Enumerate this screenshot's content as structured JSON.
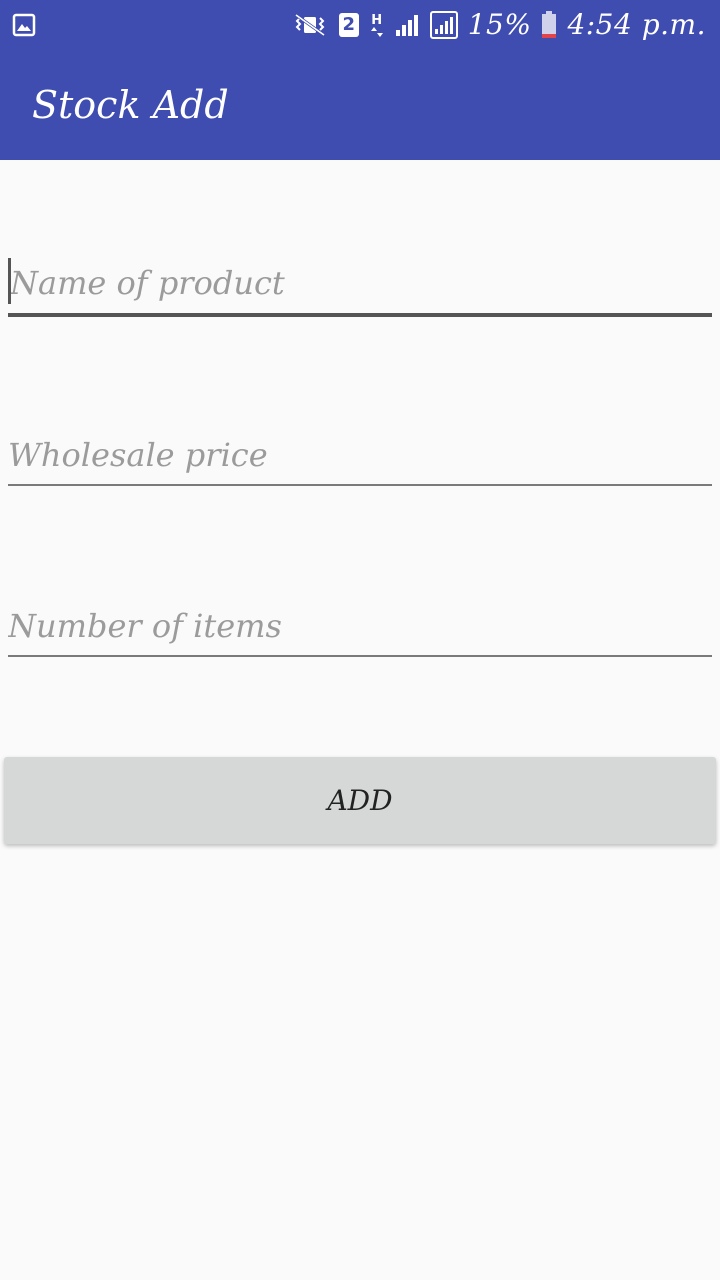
{
  "status_bar": {
    "left_icon": "gallery-notification-icon",
    "icons": [
      "vibrate-icon",
      "sim-2-icon",
      "hspa-data-icon",
      "signal-icon",
      "signal-sim2-icon",
      "battery-icon"
    ],
    "sim_label": "2",
    "network_label": "H",
    "battery_percent": "15%",
    "time": "4:54 p.m."
  },
  "toolbar": {
    "title": "Stock Add"
  },
  "form": {
    "name_placeholder": "Name of product",
    "price_placeholder": "Wholesale price",
    "count_placeholder": "Number of items",
    "add_label": "ADD"
  },
  "colors": {
    "primary": "#3f4cb0",
    "background": "#fafafa",
    "button": "#d6d7d7",
    "hint": "#9b9b9b"
  }
}
